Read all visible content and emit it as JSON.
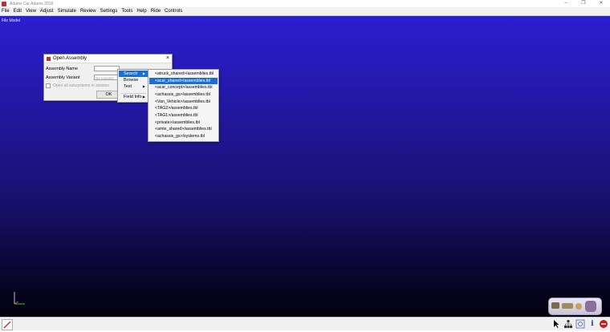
{
  "window": {
    "title": "Adams Car Adams 2018"
  },
  "menubar": [
    "File",
    "Edit",
    "View",
    "Adjust",
    "Simulate",
    "Review",
    "Settings",
    "Tools",
    "Help",
    "Ride",
    "Controls"
  ],
  "viewport": {
    "mode_label": "File Model"
  },
  "dialog": {
    "title": "Open Assembly",
    "assembly_name_label": "Assembly Name",
    "assembly_variant_label": "Assembly Variant",
    "variant_placeholder": "No variants",
    "checkbox_label": "Open all subsystems in session",
    "ok_label": "OK",
    "close_glyph": "×"
  },
  "context_menu": {
    "items": [
      {
        "label": "Search",
        "submenu": true
      },
      {
        "label": "Browse",
        "submenu": false
      },
      {
        "label": "Text",
        "submenu": true
      },
      {
        "label": "Field Info",
        "submenu": true
      }
    ]
  },
  "submenu": {
    "items": [
      "<atruck_shared>/assemblies.tbl",
      "<acar_shared>/assemblies.tbl",
      "<acar_concept>/assemblies.tbl",
      "<achassis_gs>/assemblies.tbl",
      "<Van_Vehicle>/assemblies.tbl",
      "<TAG2>/assemblies.tbl",
      "<TAG1>/assemblies.tbl",
      "<private>/assemblies.tbl",
      "<amte_shared>/assemblies.tbl",
      "<achassis_gs>/systems.tbl"
    ],
    "active_index": 1
  },
  "icons": {
    "app": "app-icon",
    "pencil": "pencil-icon",
    "cursor": "cursor-icon",
    "hierarchy": "hierarchy-icon",
    "view": "view-icon",
    "info": "info-icon",
    "stop": "stop-icon"
  },
  "colors": {
    "accent": "#1c6fd1",
    "viewport_top": "#2b1fd0",
    "viewport_bottom": "#02010d"
  }
}
